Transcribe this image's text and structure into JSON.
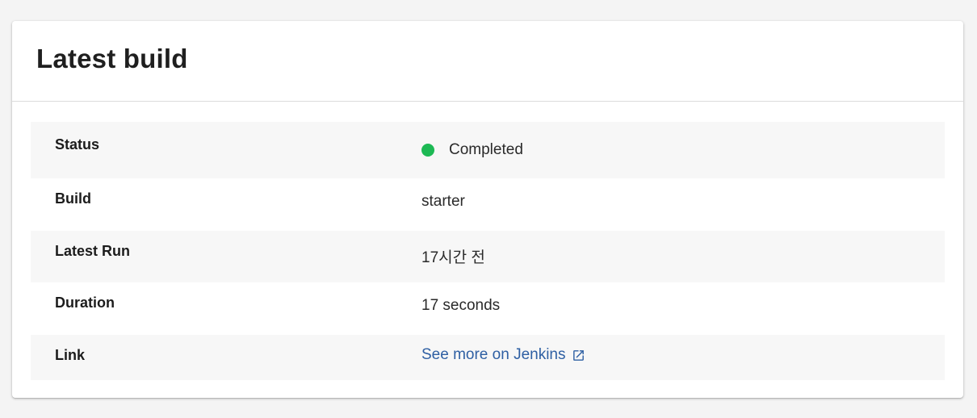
{
  "card": {
    "title": "Latest build"
  },
  "rows": [
    {
      "label": "Status",
      "value": "Completed",
      "status_color": "#1db954"
    },
    {
      "label": "Build",
      "value": "starter"
    },
    {
      "label": "Latest Run",
      "value": "17시간 전"
    },
    {
      "label": "Duration",
      "value": "17 seconds"
    },
    {
      "label": "Link",
      "value": "See more on Jenkins",
      "link_color": "#2e5fa3",
      "icon": "external-link-icon"
    }
  ]
}
